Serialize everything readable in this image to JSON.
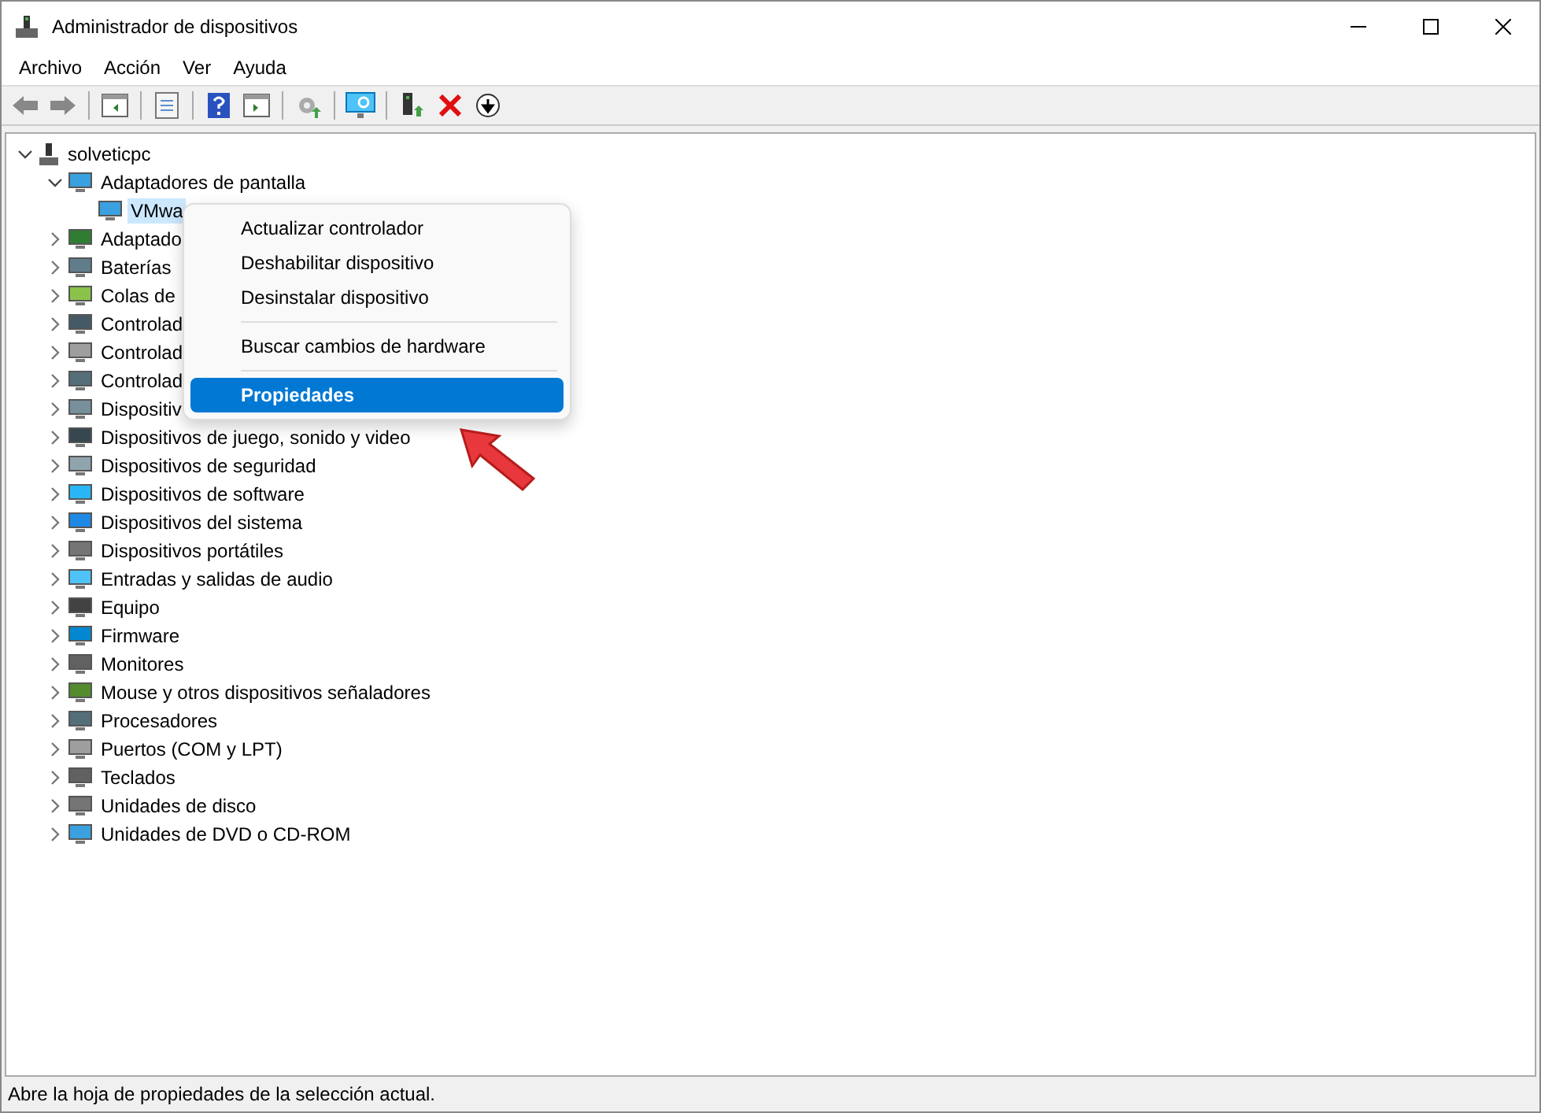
{
  "window": {
    "title": "Administrador de dispositivos"
  },
  "menu_bar": [
    "Archivo",
    "Acción",
    "Ver",
    "Ayuda"
  ],
  "tree": {
    "label": "solveticpc",
    "expanded": true,
    "children": [
      {
        "label": "Adaptadores de pantalla",
        "expanded": true,
        "children": [
          {
            "label": "VMwa",
            "selected": true
          }
        ]
      },
      {
        "label": "Adaptado",
        "expanded": false
      },
      {
        "label": "Baterías",
        "expanded": false
      },
      {
        "label": "Colas de",
        "expanded": false
      },
      {
        "label": "Controlad",
        "expanded": false
      },
      {
        "label": "Controlad",
        "expanded": false
      },
      {
        "label": "Controlad",
        "expanded": false
      },
      {
        "label": "Dispositiv",
        "expanded": false
      },
      {
        "label": "Dispositivos de juego, sonido y video",
        "expanded": false
      },
      {
        "label": "Dispositivos de seguridad",
        "expanded": false
      },
      {
        "label": "Dispositivos de software",
        "expanded": false
      },
      {
        "label": "Dispositivos del sistema",
        "expanded": false
      },
      {
        "label": "Dispositivos portátiles",
        "expanded": false
      },
      {
        "label": "Entradas y salidas de audio",
        "expanded": false
      },
      {
        "label": "Equipo",
        "expanded": false
      },
      {
        "label": "Firmware",
        "expanded": false
      },
      {
        "label": "Monitores",
        "expanded": false
      },
      {
        "label": "Mouse y otros dispositivos señaladores",
        "expanded": false
      },
      {
        "label": "Procesadores",
        "expanded": false
      },
      {
        "label": "Puertos (COM y LPT)",
        "expanded": false
      },
      {
        "label": "Teclados",
        "expanded": false
      },
      {
        "label": "Unidades de disco",
        "expanded": false
      },
      {
        "label": "Unidades de DVD o CD-ROM",
        "expanded": false
      }
    ]
  },
  "context_menu": [
    {
      "kind": "item",
      "label": "Actualizar controlador",
      "selected": false
    },
    {
      "kind": "item",
      "label": "Deshabilitar dispositivo",
      "selected": false
    },
    {
      "kind": "item",
      "label": "Desinstalar dispositivo",
      "selected": false
    },
    {
      "kind": "separator"
    },
    {
      "kind": "item",
      "label": "Buscar cambios de hardware",
      "selected": false
    },
    {
      "kind": "separator"
    },
    {
      "kind": "item",
      "label": "Propiedades",
      "selected": true
    }
  ],
  "status_bar": "Abre la hoja de propiedades de la selección actual."
}
